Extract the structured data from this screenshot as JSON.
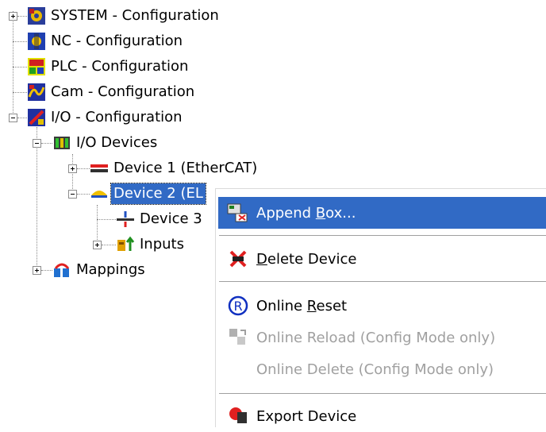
{
  "tree": {
    "items": [
      {
        "label": "SYSTEM - Configuration",
        "icon": "system-config-icon"
      },
      {
        "label": "NC - Configuration",
        "icon": "nc-config-icon"
      },
      {
        "label": "PLC - Configuration",
        "icon": "plc-config-icon"
      },
      {
        "label": "Cam - Configuration",
        "icon": "cam-config-icon"
      },
      {
        "label": "I/O - Configuration",
        "icon": "io-config-icon"
      },
      {
        "label": "I/O Devices",
        "icon": "io-devices-icon"
      },
      {
        "label": "Device 1 (EtherCAT)",
        "icon": "ethercat-device-icon"
      },
      {
        "label": "Device 2 (EL",
        "icon": "device-icon",
        "selected": true
      },
      {
        "label": "Device 3",
        "icon": "device-image-icon"
      },
      {
        "label": "Inputs",
        "icon": "inputs-icon"
      },
      {
        "label": "Mappings",
        "icon": "mappings-icon"
      }
    ]
  },
  "context_menu": {
    "items": [
      {
        "pre": "Append ",
        "key": "B",
        "post": "ox...",
        "icon": "append-box-icon",
        "highlighted": true
      },
      {
        "pre": "",
        "key": "D",
        "post": "elete Device",
        "icon": "delete-device-icon"
      },
      {
        "pre": "Online ",
        "key": "R",
        "post": "eset",
        "icon": "online-reset-icon"
      },
      {
        "pre": "Online Reload (Config Mode only)",
        "key": "",
        "post": "",
        "icon": "online-reload-icon",
        "disabled": true
      },
      {
        "pre": "Online Delete (Config Mode only)",
        "key": "",
        "post": "",
        "icon": "",
        "disabled": true
      },
      {
        "pre": "Export Device",
        "key": "",
        "post": "",
        "icon": "export-device-icon"
      }
    ]
  }
}
